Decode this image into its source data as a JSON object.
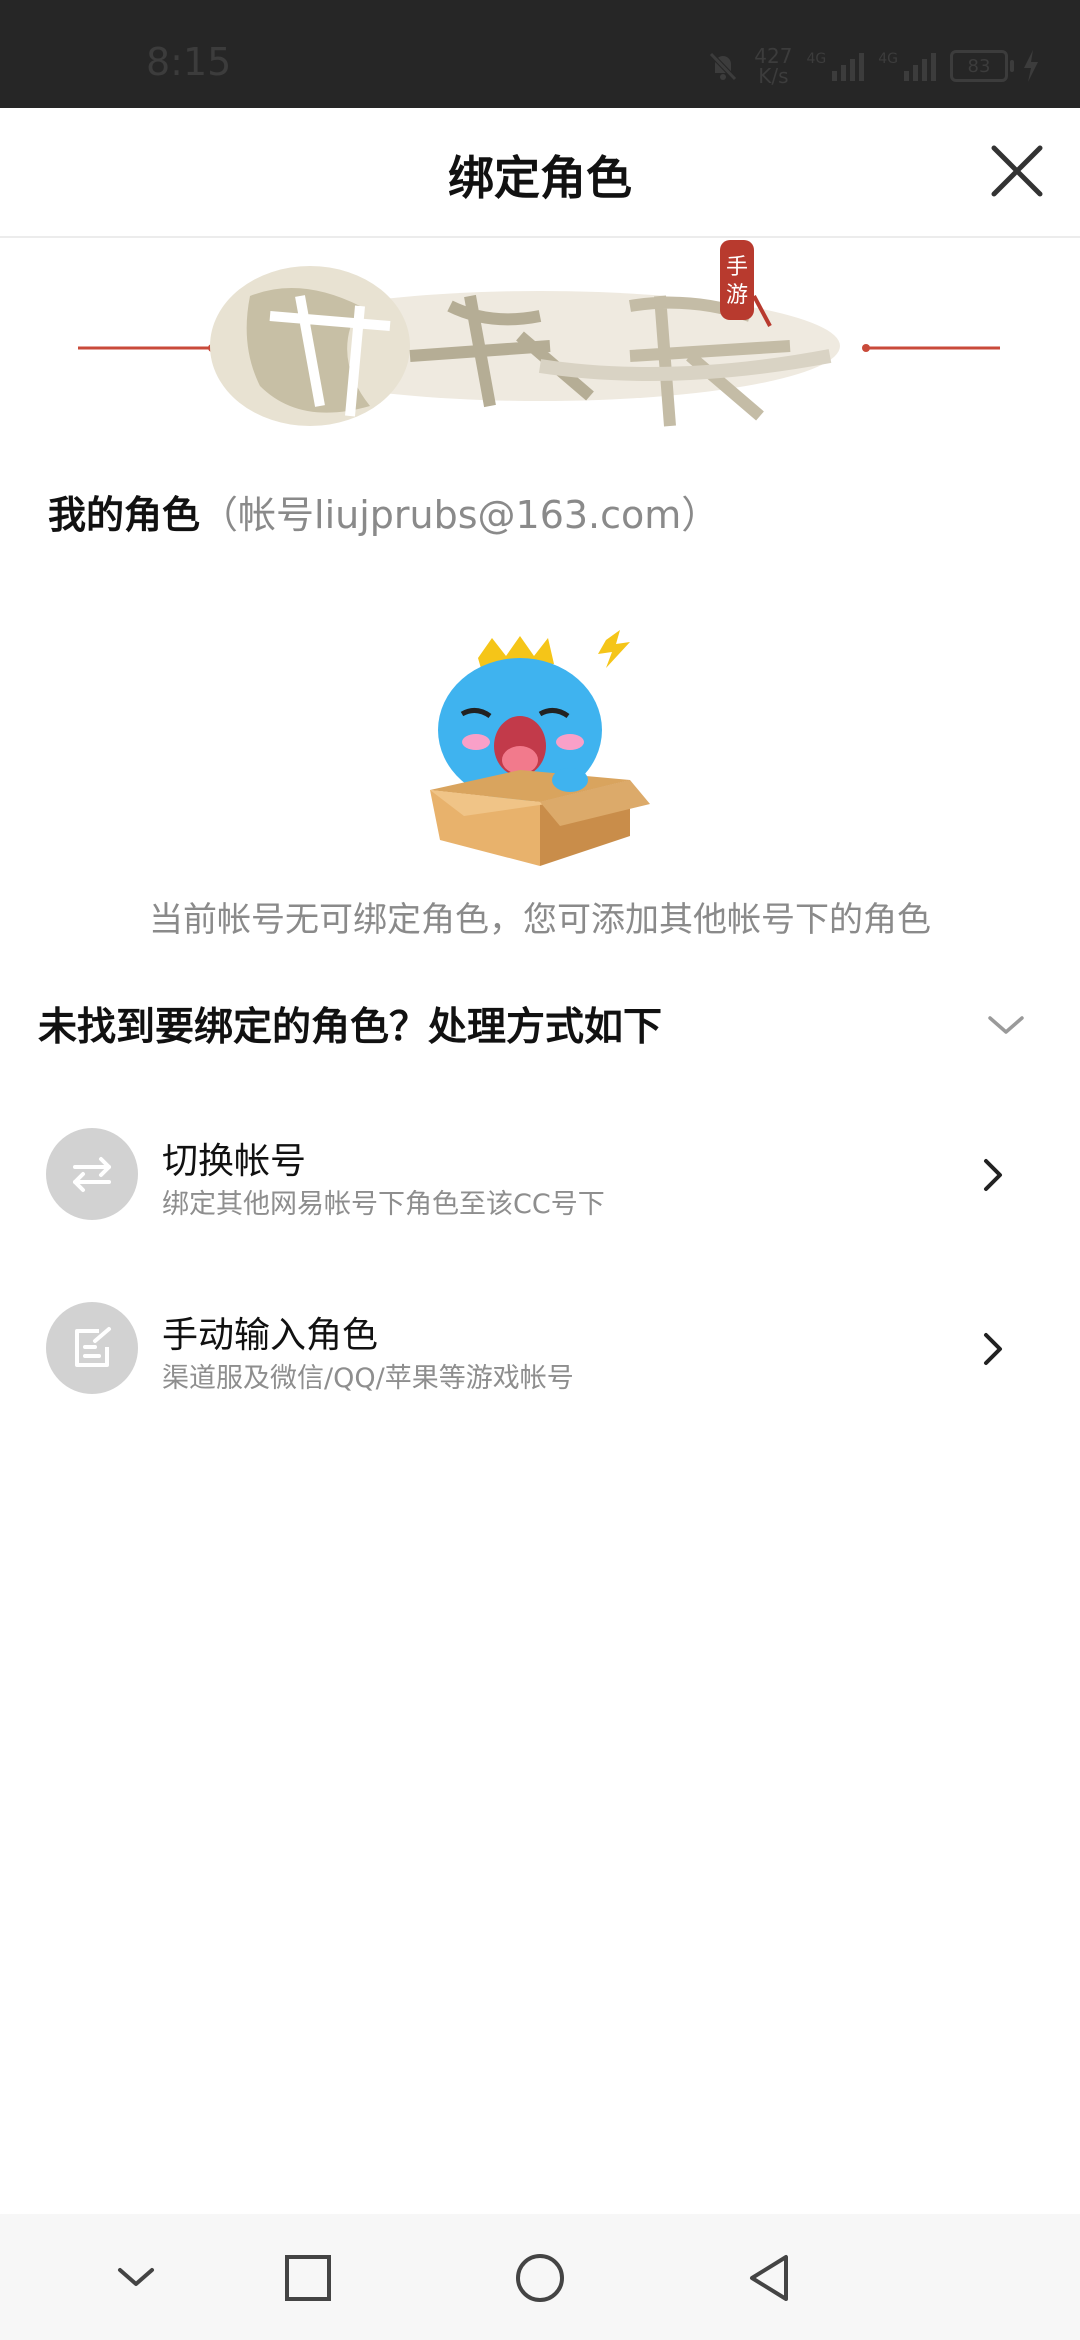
{
  "status_bar": {
    "time": "8:15",
    "speed_value": "427",
    "speed_unit": "K/s",
    "network_1": "4G",
    "network_2": "4G",
    "battery": "83"
  },
  "header": {
    "title": "绑定角色"
  },
  "my_roles": {
    "label": "我的角色",
    "account": "（帐号liujprubs@163.com）"
  },
  "empty_state": {
    "message": "当前帐号无可绑定角色，您可添加其他帐号下的角色"
  },
  "help": {
    "title": "未找到要绑定的角色？处理方式如下",
    "options": [
      {
        "title": "切换帐号",
        "subtitle": "绑定其他网易帐号下角色至该CC号下",
        "icon": "switch-arrows-icon"
      },
      {
        "title": "手动输入角色",
        "subtitle": "渠道服及微信/QQ/苹果等游戏帐号",
        "icon": "edit-note-icon"
      }
    ]
  },
  "colors": {
    "status_bar_bg": "#262626",
    "icon_circle_bg": "#d2d2d2",
    "secondary_text": "#8a8a8a"
  }
}
